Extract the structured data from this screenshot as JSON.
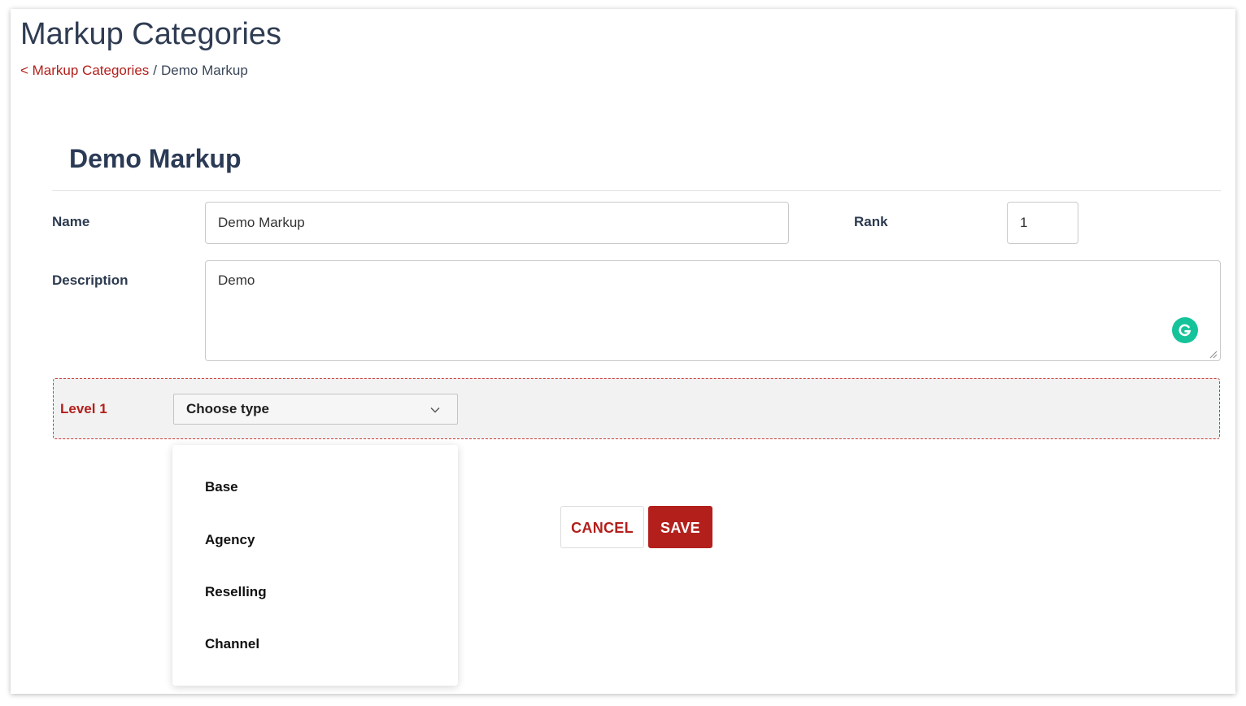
{
  "header": {
    "title": "Markup Categories",
    "breadcrumb": {
      "back_link": "< Markup Categories",
      "separator": "/",
      "current": "Demo Markup"
    }
  },
  "form": {
    "section_title": "Demo Markup",
    "name": {
      "label": "Name",
      "value": "Demo Markup"
    },
    "rank": {
      "label": "Rank",
      "value": "1"
    },
    "description": {
      "label": "Description",
      "value": "Demo"
    },
    "level": {
      "label": "Level 1",
      "select_value": "Choose type",
      "options": [
        "Base",
        "Agency",
        "Reselling",
        "Channel"
      ]
    },
    "actions": {
      "cancel_label": "CANCEL",
      "save_label": "SAVE"
    }
  },
  "icons": {
    "grammarly": "grammarly-icon",
    "chevron": "chevron-down-icon",
    "resize": "resize-grip-icon"
  },
  "colors": {
    "accent": "#b3201c",
    "title_text": "#2f3c52",
    "level_box_background": "#f2f2f2",
    "grammarly": "#15c39a"
  }
}
